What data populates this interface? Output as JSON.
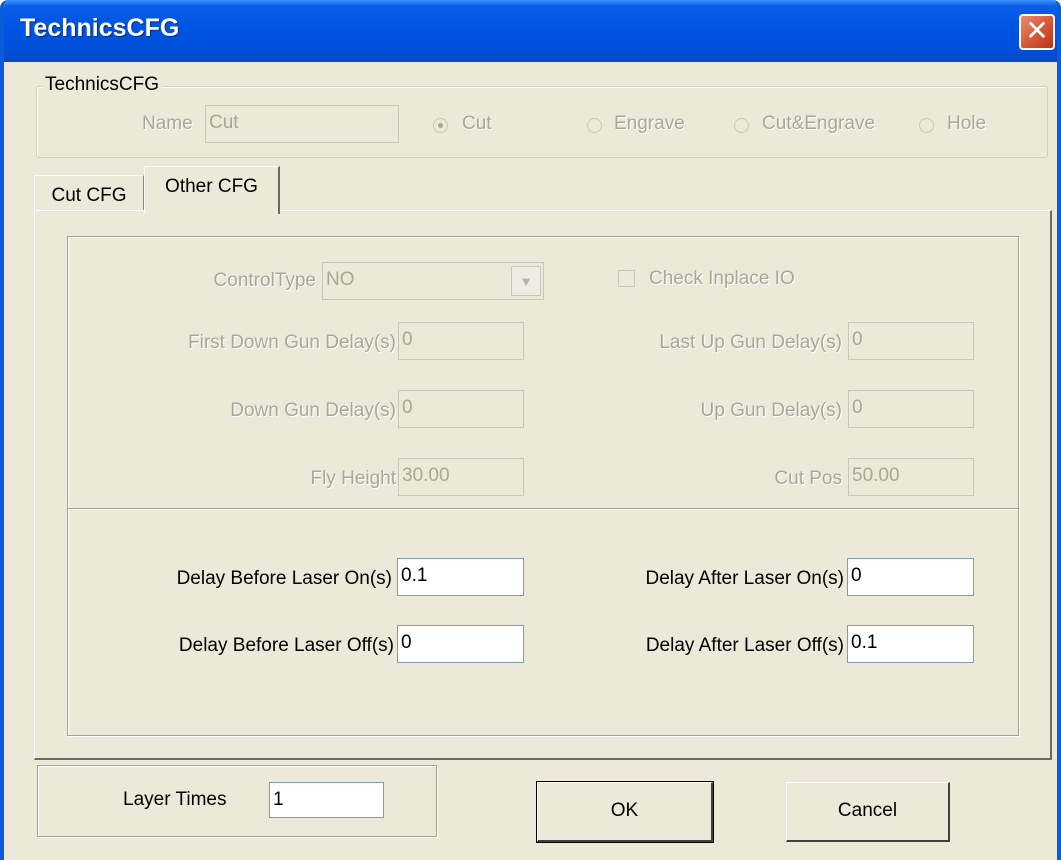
{
  "window": {
    "title": "TechnicsCFG",
    "close_glyph": "✕"
  },
  "technics_group": {
    "legend": "TechnicsCFG",
    "name_label": "Name",
    "name_value": "Cut",
    "radios": [
      {
        "label": "Cut",
        "checked": true
      },
      {
        "label": "Engrave",
        "checked": false
      },
      {
        "label": "Cut&Engrave",
        "checked": false
      },
      {
        "label": "Hole",
        "checked": false
      }
    ]
  },
  "tabs": [
    {
      "label": "Cut CFG",
      "active": false
    },
    {
      "label": "Other CFG",
      "active": true
    }
  ],
  "other_cfg": {
    "control_type_label": "ControlType",
    "control_type_value": "NO",
    "check_inplace_label": "Check Inplace IO",
    "first_down_gun_delay_label": "First Down Gun Delay(s)",
    "first_down_gun_delay_value": "0",
    "last_up_gun_delay_label": "Last Up Gun Delay(s)",
    "last_up_gun_delay_value": "0",
    "down_gun_delay_label": "Down Gun Delay(s)",
    "down_gun_delay_value": "0",
    "up_gun_delay_label": "Up Gun Delay(s)",
    "up_gun_delay_value": "0",
    "fly_height_label": "Fly Height",
    "fly_height_value": "30.00",
    "cut_pos_label": "Cut Pos",
    "cut_pos_value": "50.00",
    "delay_before_laser_on_label": "Delay Before Laser On(s)",
    "delay_before_laser_on_value": "0.1",
    "delay_after_laser_on_label": "Delay After Laser On(s)",
    "delay_after_laser_on_value": "0",
    "delay_before_laser_off_label": "Delay Before Laser Off(s)",
    "delay_before_laser_off_value": "0",
    "delay_after_laser_off_label": "Delay After Laser Off(s)",
    "delay_after_laser_off_value": "0.1"
  },
  "footer": {
    "layer_times_label": "Layer Times",
    "layer_times_value": "1",
    "ok_label": "OK",
    "cancel_label": "Cancel"
  },
  "icons": {
    "combo_arrow": "chevron-down-icon",
    "close": "close-icon"
  },
  "colors": {
    "titlebar": "#0054e3",
    "face": "#ece9d8",
    "disabled_text": "#a9a798",
    "close": "#d85a3a"
  }
}
